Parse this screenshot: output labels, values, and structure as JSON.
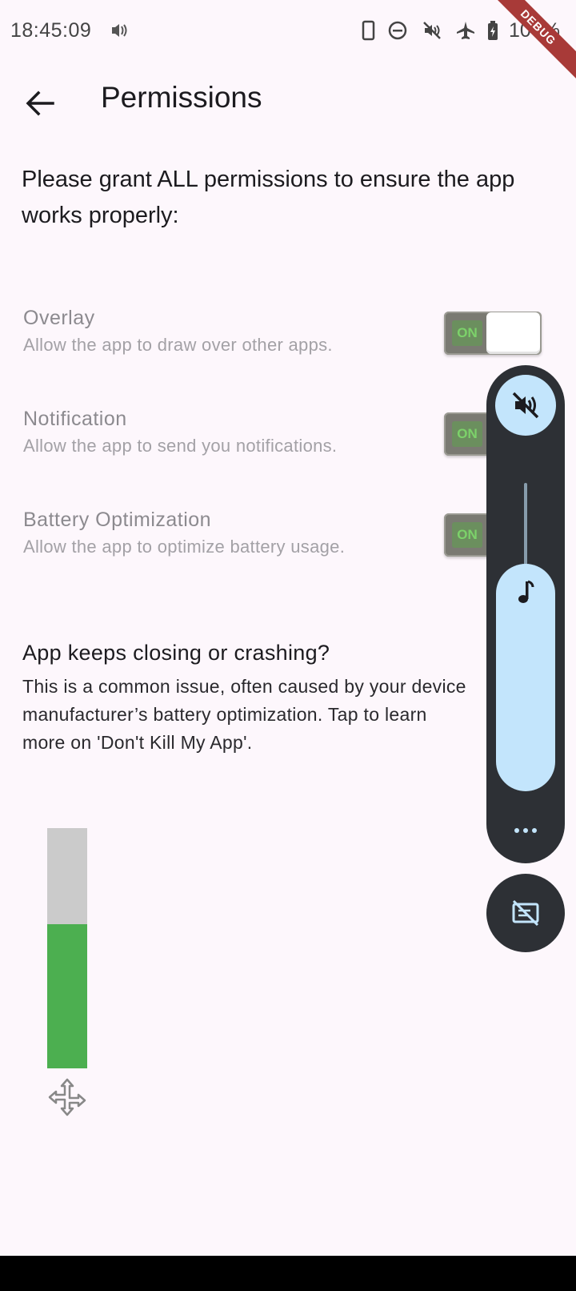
{
  "status_bar": {
    "time": "18:45:09",
    "battery_percent": "100%",
    "debug_label": "DEBUG",
    "icons": [
      "volume-vibrate-icon",
      "phone-icon",
      "do-not-disturb-icon",
      "mute-icon",
      "airplane-icon",
      "battery-charging-icon"
    ]
  },
  "app_bar": {
    "title": "Permissions",
    "back_icon": "arrow-back-icon"
  },
  "intro_text": "Please grant ALL permissions to ensure the app works properly:",
  "permissions": [
    {
      "title": "Overlay",
      "description": "Allow the app to draw over other apps.",
      "toggle_label": "ON",
      "enabled": true
    },
    {
      "title": "Notification",
      "description": "Allow the app to send you notifications.",
      "toggle_label": "ON",
      "enabled": true
    },
    {
      "title": "Battery Optimization",
      "description": "Allow the app to optimize battery usage.",
      "toggle_label": "ON",
      "enabled": true
    }
  ],
  "crash_help": {
    "title": "App keeps closing or crashing?",
    "body": "This is a common issue, often caused by your device manufacturer’s battery optimization. Tap to learn more on 'Don't Kill My App'."
  },
  "level_indicator": {
    "fill_fraction": 0.6,
    "fill_color": "#4caf50",
    "track_color": "#cbcbcb",
    "handle_icon": "move-arrows-icon"
  },
  "volume_panel": {
    "mute_icon": "volume-off-icon",
    "stream_icon": "music-note-icon",
    "more_icon": "more-horiz-icon",
    "caption_icon": "captions-off-icon",
    "accent_color": "#c3e5fc"
  }
}
